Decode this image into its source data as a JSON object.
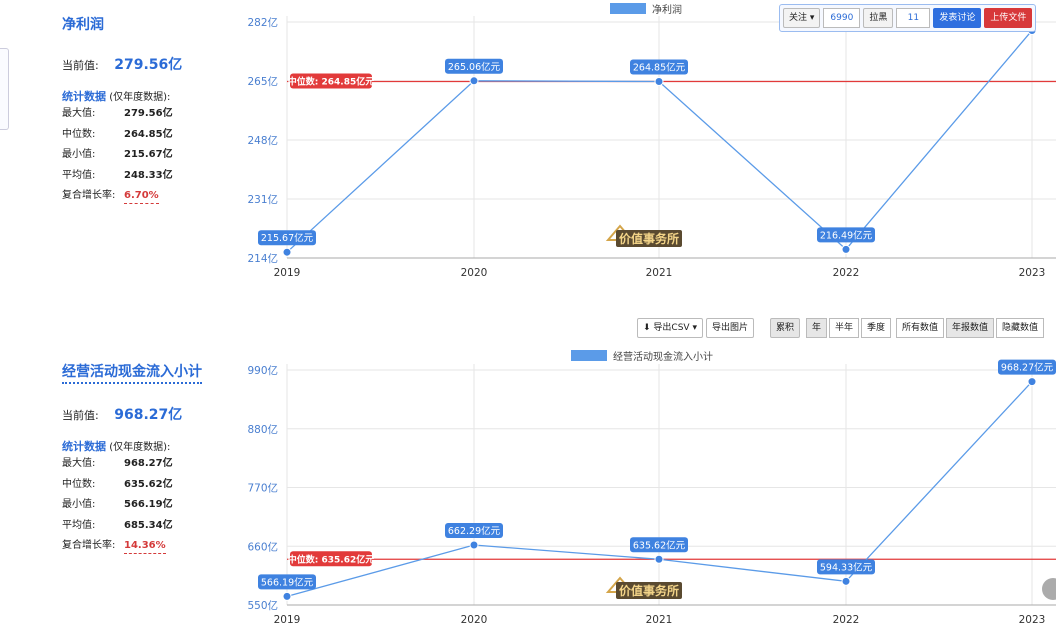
{
  "toolbar": {
    "follow_label": "关注",
    "follow_count": "6990",
    "block_label": "拉黑",
    "block_count": "11",
    "discuss_label": "发表讨论",
    "upload_label": "上传文件",
    "export_csv_label": "导出CSV",
    "export_image_label": "导出图片",
    "cumulative_label": "累积",
    "period_options": [
      "年",
      "半年",
      "季度"
    ],
    "value_options": [
      "所有数值",
      "年报数值",
      "隐藏数值"
    ]
  },
  "watermark": "价值事务所",
  "panels": [
    {
      "stats": {
        "title": "净利润",
        "current_label": "当前值:",
        "current_value": "279.56亿",
        "header_bold": "统计数据",
        "header_note": "(仅年度数据):",
        "rows": [
          {
            "k": "最大值:",
            "v": "279.56亿"
          },
          {
            "k": "中位数:",
            "v": "264.85亿"
          },
          {
            "k": "最小值:",
            "v": "215.67亿"
          },
          {
            "k": "平均值:",
            "v": "248.33亿"
          },
          {
            "k": "复合增长率:",
            "v": "6.70%"
          }
        ]
      },
      "chart": {
        "legend": "净利润",
        "median_label": "中位数: 264.85亿元",
        "y_tick_labels": [
          "282亿",
          "265亿",
          "248亿",
          "231亿",
          "214亿"
        ],
        "x_tick_labels": [
          "2019",
          "2020",
          "2021",
          "2022",
          "2023"
        ],
        "point_labels": [
          "215.67亿元",
          "265.06亿元",
          "264.85亿元",
          "216.49亿元",
          ""
        ]
      }
    },
    {
      "stats": {
        "title": "经营活动现金流入小计",
        "current_label": "当前值:",
        "current_value": "968.27亿",
        "header_bold": "统计数据",
        "header_note": "(仅年度数据):",
        "rows": [
          {
            "k": "最大值:",
            "v": "968.27亿"
          },
          {
            "k": "中位数:",
            "v": "635.62亿"
          },
          {
            "k": "最小值:",
            "v": "566.19亿"
          },
          {
            "k": "平均值:",
            "v": "685.34亿"
          },
          {
            "k": "复合增长率:",
            "v": "14.36%"
          }
        ]
      },
      "chart": {
        "legend": "经营活动现金流入小计",
        "median_label": "中位数: 635.62亿元",
        "y_tick_labels": [
          "990亿",
          "880亿",
          "770亿",
          "660亿",
          "550亿"
        ],
        "x_tick_labels": [
          "2019",
          "2020",
          "2021",
          "2022",
          "2023"
        ],
        "point_labels": [
          "566.19亿元",
          "662.29亿元",
          "635.62亿元",
          "594.33亿元",
          "968.27亿元"
        ]
      }
    }
  ],
  "chart_data": [
    {
      "type": "line",
      "title": "",
      "x": [
        2019,
        2020,
        2021,
        2022,
        2023
      ],
      "series": [
        {
          "name": "净利润",
          "values": [
            215.67,
            265.06,
            264.85,
            216.49,
            279.56
          ],
          "color": "#5b9be8"
        }
      ],
      "median": 264.85,
      "median_color": "#e23a3a",
      "ylim": [
        214,
        282
      ],
      "yticks": [
        282,
        265,
        248,
        231,
        214
      ],
      "grid": true
    },
    {
      "type": "line",
      "title": "",
      "x": [
        2019,
        2020,
        2021,
        2022,
        2023
      ],
      "series": [
        {
          "name": "经营活动现金流入小计",
          "values": [
            566.19,
            662.29,
            635.62,
            594.33,
            968.27
          ],
          "color": "#5b9be8"
        }
      ],
      "median": 635.62,
      "median_color": "#e23a3a",
      "ylim": [
        550,
        990
      ],
      "yticks": [
        990,
        880,
        770,
        660,
        550
      ],
      "grid": true
    }
  ]
}
